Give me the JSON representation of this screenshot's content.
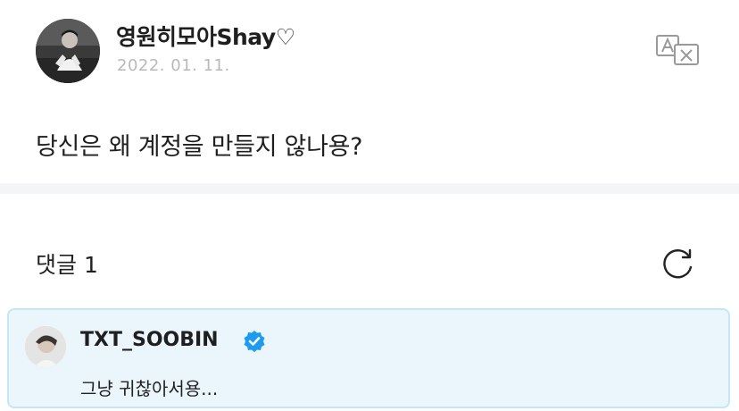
{
  "post": {
    "author_name": "영원히모아Shay♡",
    "date": "2022. 01. 11.",
    "body": "당신은 왜 계정을 만들지 않나용?"
  },
  "toolbar": {
    "translate_icon": "translate-icon"
  },
  "comments": {
    "label": "댓글 1",
    "refresh_icon": "refresh-icon",
    "items": [
      {
        "author": "TXT_SOOBIN",
        "verified": true,
        "text": "그냥 귀찮아서용..."
      }
    ]
  },
  "colors": {
    "date_gray": "#b9b9b9",
    "divider": "#f4f5f6",
    "comment_bg": "#eaf6fc",
    "comment_border": "#c5e6f5",
    "verified_blue": "#1d9bf0"
  }
}
